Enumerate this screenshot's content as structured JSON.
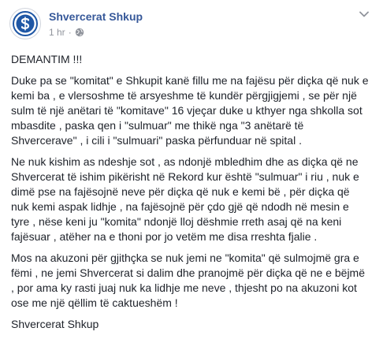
{
  "post": {
    "page_name": "Shvercerat Shkup",
    "timestamp": "1 hr",
    "separator": "·",
    "avatar_icon": "dollar-logo-icon",
    "privacy_icon": "globe-icon",
    "more_icon": "chevron-down-icon",
    "colors": {
      "page_name": "#365899",
      "meta_text": "#90949c",
      "body_text": "#1d2129",
      "logo_blue": "#1f57a5"
    },
    "paragraphs": [
      "DEMANTIM !!!",
      "Duke pa se \"komitat\" e Shkupit kanë fillu me na fajësu për diçka që nuk e kemi ba , e vlersoshme të arsyeshme të kundër përgjigjemi , se për një sulm të një anëtari të \"komitave\" 16 vjeçar duke u kthyer nga shkolla sot mbasdite , paska qen i \"sulmuar\" me thikë nga \"3 anëtarë të Shvercerave\" , i cili i \"sulmuari\" paska përfunduar në spital .",
      "Ne nuk kishim as ndeshje sot , as ndonjë mbledhim dhe as diçka që ne Shvercerat të ishim pikërisht në Rekord kur është \"sulmuar\" i riu , nuk e dimë pse na fajësojnë neve për diçka që nuk e kemi bë , për diçka që nuk kemi aspak lidhje , na fajësojnë për çdo gjë që ndodh në mesin e tyre , nëse keni ju \"komita\" ndonjë lloj dëshmie rreth asaj që na keni fajësuar , atëher na e thoni por jo vetëm me disa rreshta fjalie .",
      "Mos na akuzoni për gjithçka se nuk jemi ne \"komita\" që sulmojmë gra e fëmi , ne jemi Shvercerat si dalim dhe pranojmë për diçka që ne e bëjmë , por ama ky rasti juaj nuk ka lidhje me neve , thjesht po na akuzoni kot ose me një qëllim të caktueshëm !",
      "Shvercerat Shkup"
    ]
  }
}
